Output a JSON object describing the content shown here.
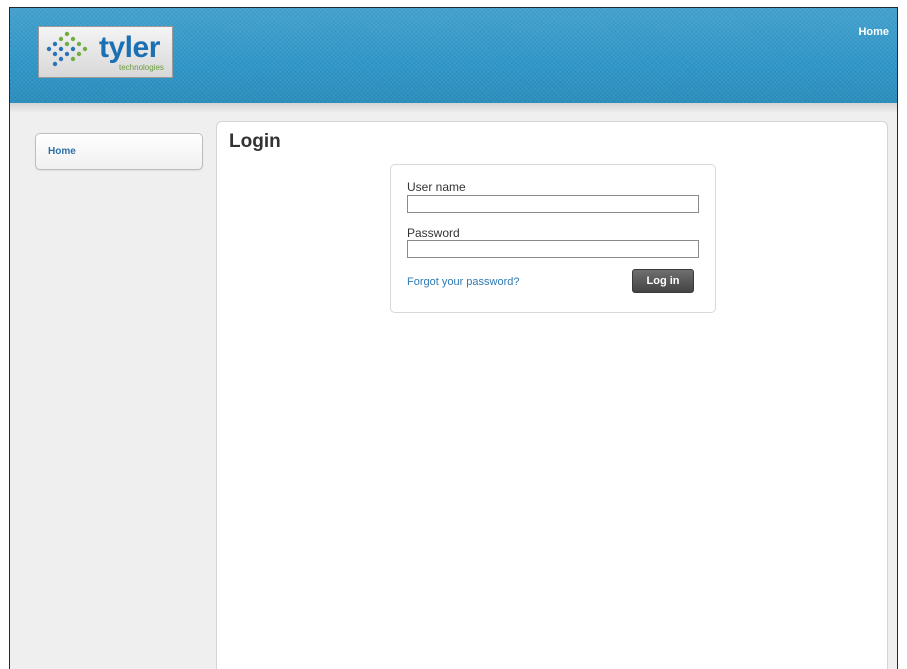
{
  "header": {
    "logo_text": "tyler",
    "logo_subtext": "technologies",
    "nav_home": "Home"
  },
  "sidebar": {
    "items": [
      {
        "label": "Home"
      }
    ]
  },
  "main": {
    "title": "Login",
    "form": {
      "username_label": "User name",
      "username_value": "",
      "password_label": "Password",
      "password_value": "",
      "forgot_link": "Forgot your password?",
      "submit_label": "Log in"
    }
  },
  "colors": {
    "header_blue": "#2f97c9",
    "link_blue": "#2e7ab3",
    "logo_blue": "#1b6fb3",
    "logo_green": "#6a9c3d",
    "button_dark": "#555555"
  },
  "icons": {
    "logo_mark": "tyler-dots-logo-icon"
  }
}
